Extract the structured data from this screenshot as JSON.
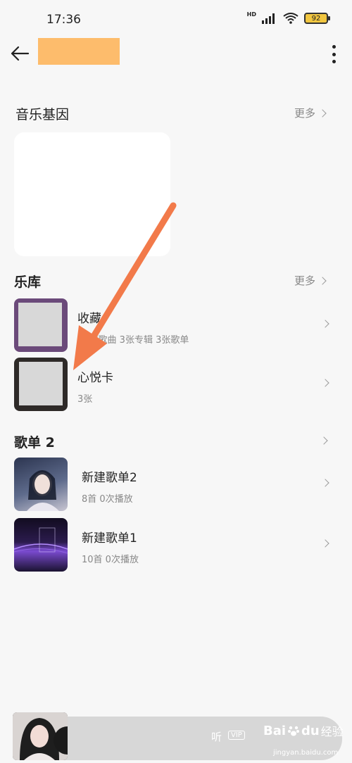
{
  "status_bar": {
    "time": "17:36",
    "battery": "92",
    "network": "HD"
  },
  "header": {
    "back_icon": "back-arrow-icon",
    "more_icon": "more-vert-icon"
  },
  "music_gene": {
    "title": "音乐基因",
    "more_label": "更多"
  },
  "library": {
    "title": "乐库",
    "more_label": "更多",
    "items": [
      {
        "title": "收藏",
        "subtitle": "19首歌曲 3张专辑 3张歌单"
      },
      {
        "title": "心悦卡",
        "subtitle": "3张"
      }
    ]
  },
  "playlists": {
    "title": "歌单 2",
    "items": [
      {
        "title": "新建歌单2",
        "subtitle": "8首 0次播放"
      },
      {
        "title": "新建歌单1",
        "subtitle": "10首 0次播放"
      }
    ]
  },
  "player": {
    "listen_label": "听",
    "vip_label": "VIP"
  },
  "watermark": {
    "brand": "Bai",
    "brand2": "du",
    "suffix": "经验",
    "url": "jingyan.baidu.com"
  },
  "colors": {
    "accent_arrow": "#f27a4a",
    "title_block": "#fdbc6c",
    "background": "#f7f7f7"
  }
}
